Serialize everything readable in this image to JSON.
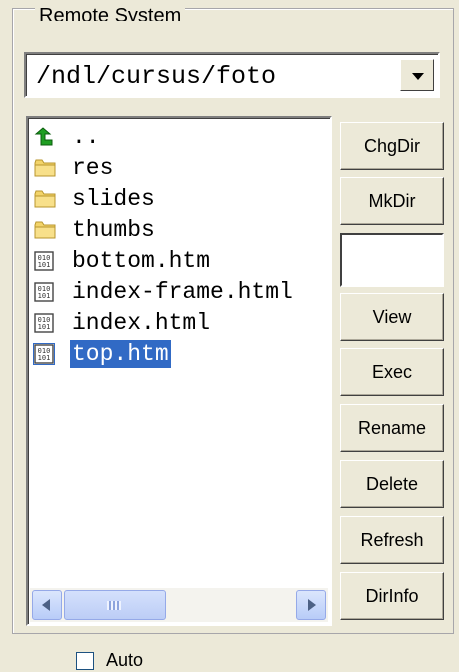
{
  "group": {
    "title": "Remote System"
  },
  "path_combo": {
    "value": "/ndl/cursus/foto"
  },
  "files": [
    {
      "name": "..",
      "icon": "up-folder-icon",
      "selected": false
    },
    {
      "name": "res",
      "icon": "folder-icon",
      "selected": false
    },
    {
      "name": "slides",
      "icon": "folder-icon",
      "selected": false
    },
    {
      "name": "thumbs",
      "icon": "folder-icon",
      "selected": false
    },
    {
      "name": "bottom.htm",
      "icon": "file-icon",
      "selected": false
    },
    {
      "name": "index-frame.html",
      "icon": "file-icon",
      "selected": false
    },
    {
      "name": "index.html",
      "icon": "file-icon",
      "selected": false
    },
    {
      "name": "top.htm",
      "icon": "file-icon",
      "selected": true
    }
  ],
  "buttons": {
    "chgdir": "ChgDir",
    "mkdir": "MkDir",
    "view": "View",
    "exec": "Exec",
    "rename": "Rename",
    "delete": "Delete",
    "refresh": "Refresh",
    "dirinfo": "DirInfo"
  },
  "command_input": {
    "value": ""
  },
  "auto_checkbox": {
    "label": "Auto",
    "checked": false
  },
  "colors": {
    "selection": "#316ac5",
    "folder": "#f3d46a",
    "face": "#ece9d8"
  }
}
